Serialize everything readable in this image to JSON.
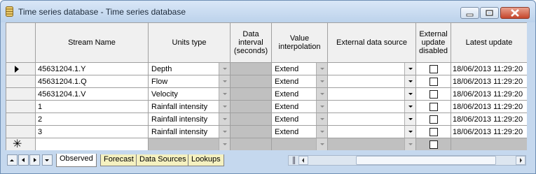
{
  "window": {
    "title": "Time series database - Time series database",
    "icon": "database-icon",
    "buttons": [
      "minimize",
      "restore",
      "close"
    ]
  },
  "columns": [
    {
      "key": "stream_name",
      "label": "Stream Name"
    },
    {
      "key": "units_type",
      "label": "Units type"
    },
    {
      "key": "data_interval",
      "label": "Data interval (seconds)"
    },
    {
      "key": "value_interpolation",
      "label": "Value interpolation"
    },
    {
      "key": "external_source",
      "label": "External data source"
    },
    {
      "key": "external_disabled",
      "label": "External update disabled"
    },
    {
      "key": "latest_update",
      "label": "Latest update"
    }
  ],
  "rows": [
    {
      "stream_name": "45631204.1.Y",
      "units_type": "Depth",
      "value_interpolation": "Extend",
      "external_disabled": false,
      "latest_update": "18/06/2013 11:29:20"
    },
    {
      "stream_name": "45631204.1.Q",
      "units_type": "Flow",
      "value_interpolation": "Extend",
      "external_disabled": false,
      "latest_update": "18/06/2013 11:29:20"
    },
    {
      "stream_name": "45631204.1.V",
      "units_type": "Velocity",
      "value_interpolation": "Extend",
      "external_disabled": false,
      "latest_update": "18/06/2013 11:29:20"
    },
    {
      "stream_name": "1",
      "units_type": "Rainfall intensity",
      "value_interpolation": "Extend",
      "external_disabled": false,
      "latest_update": "18/06/2013 11:29:20"
    },
    {
      "stream_name": "2",
      "units_type": "Rainfall intensity",
      "value_interpolation": "Extend",
      "external_disabled": false,
      "latest_update": "18/06/2013 11:29:20"
    },
    {
      "stream_name": "3",
      "units_type": "Rainfall intensity",
      "value_interpolation": "Extend",
      "external_disabled": false,
      "latest_update": "18/06/2013 11:29:20"
    }
  ],
  "new_row_marker": "✳",
  "tabs": [
    {
      "label": "Observed",
      "active": true
    },
    {
      "label": "Forecast",
      "active": false
    },
    {
      "label": "Data Sources",
      "active": false
    },
    {
      "label": "Lookups",
      "active": false
    }
  ]
}
